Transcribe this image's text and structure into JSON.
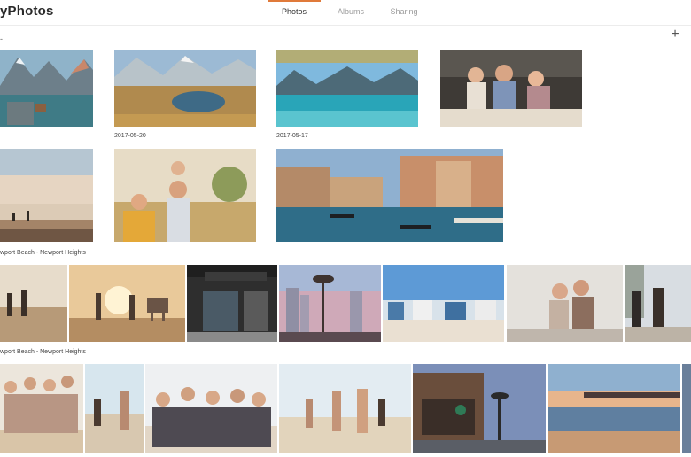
{
  "app": {
    "title": "yPhotos"
  },
  "tabs": [
    {
      "label": "Photos",
      "active": true
    },
    {
      "label": "Albums",
      "active": false
    },
    {
      "label": "Sharing",
      "active": false
    }
  ],
  "toolbar": {
    "section_marker": "-",
    "add_label": "+"
  },
  "groups": {
    "date_labels": [
      "2017-05-20",
      "2017-05-17"
    ],
    "place_labels": [
      "wport Beach - Newport Heights",
      "wport Beach - Newport Heights"
    ]
  },
  "photos": {
    "mountain_lake_dock": "mountain lake with dock",
    "alpine_meadow_pond": "alpine meadow pond",
    "turquoise_lake": "turquoise mountain lake",
    "family_dinner": "family dinner outdoors",
    "beach_sunset": "beach sunset",
    "family_piggyback": "family piggyback",
    "venice_canal": "venice canal",
    "beach_friends_1": "friends on beach",
    "beach_lifeguard": "beach lifeguard tower",
    "starbucks_store": "starbucks store",
    "palm_city": "palm trees city",
    "beach_houses": "beach houses",
    "friends_selfie": "friends selfie",
    "street_walkers": "people walking street",
    "group_beach_1": "group on beach",
    "beach_ball": "beach volleyball",
    "group_cheer": "group cheering",
    "beach_party": "beach party",
    "starbucks_night": "starbucks evening",
    "pier_sunset": "pier at sunset"
  },
  "colors": {
    "accent": "#e07a3a",
    "tab_inactive": "#9a9a9a"
  }
}
